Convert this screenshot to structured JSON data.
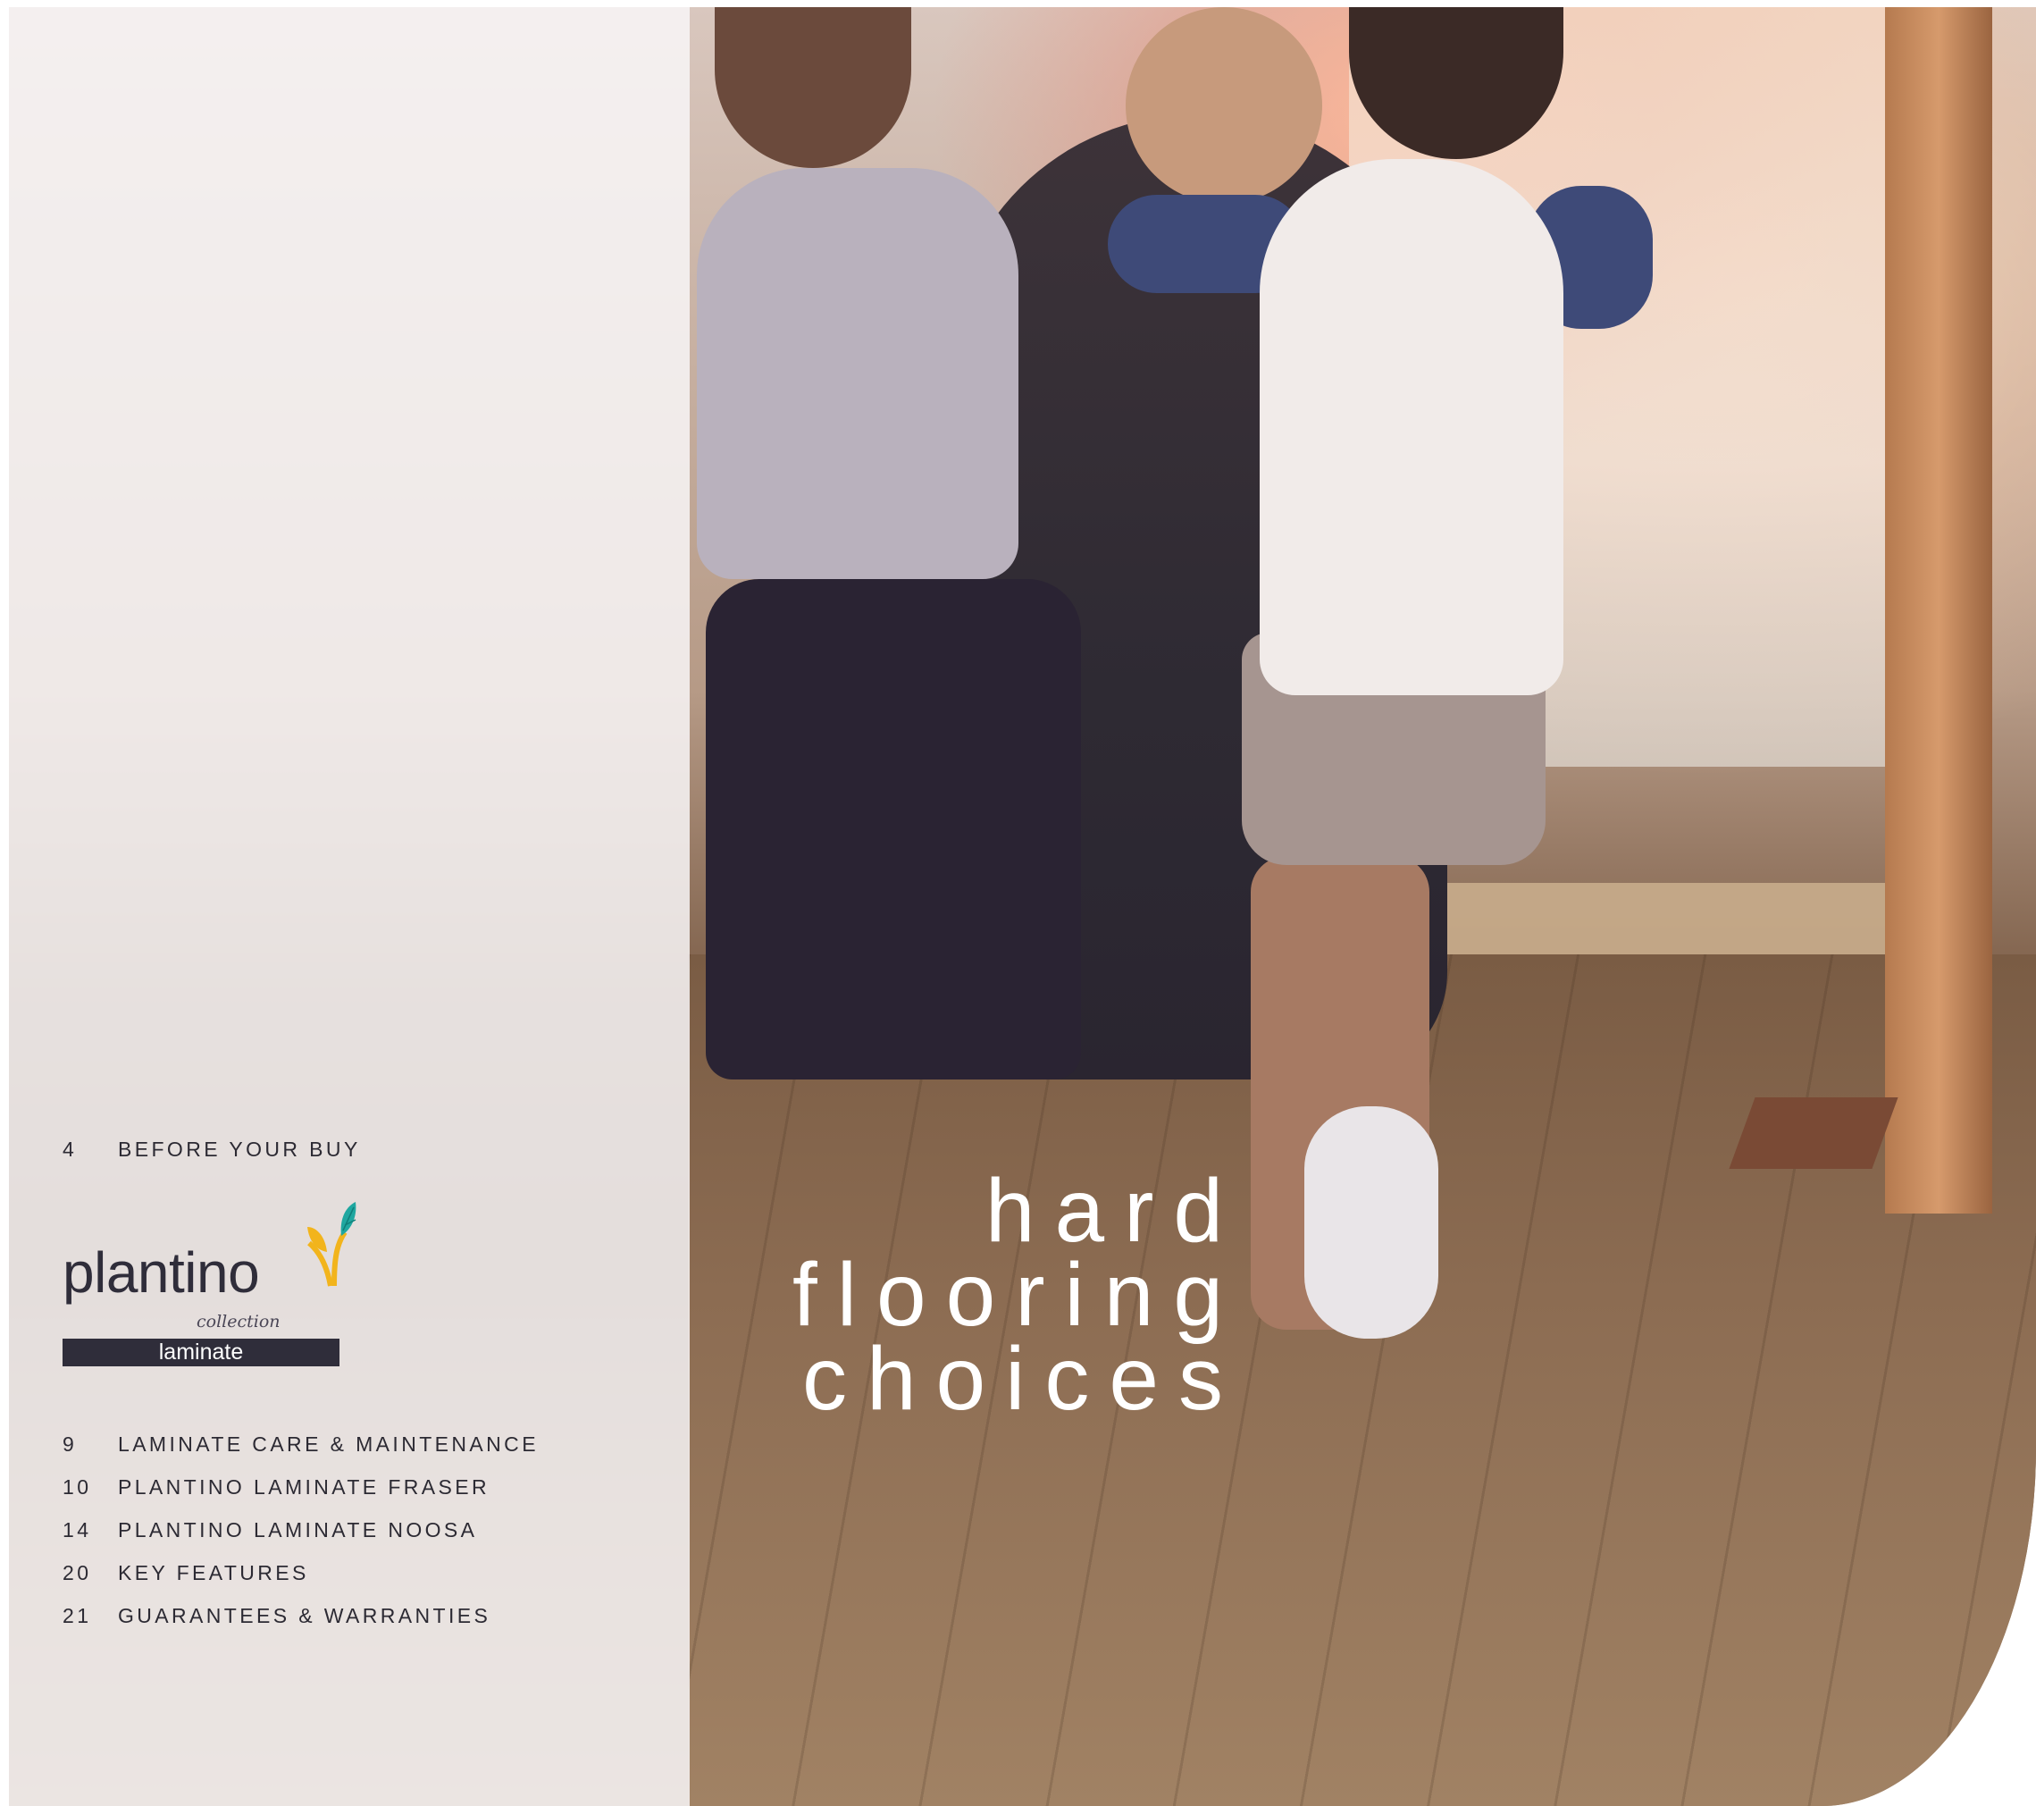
{
  "toc_top": [
    {
      "num": "4",
      "label": "BEFORE YOUR BUY"
    }
  ],
  "logo": {
    "brand": "plantino",
    "collection": "collection",
    "product": "laminate",
    "colors": {
      "teal": "#1fa7a0",
      "yellow": "#f2b41c",
      "navy": "#2f2d3a"
    }
  },
  "toc_bottom": [
    {
      "num": "9",
      "label": "LAMINATE CARE & MAINTENANCE"
    },
    {
      "num": "10",
      "label": "PLANTINO LAMINATE FRASER"
    },
    {
      "num": "14",
      "label": "PLANTINO LAMINATE NOOSA"
    },
    {
      "num": "20",
      "label": "KEY FEATURES"
    },
    {
      "num": "21",
      "label": "GUARANTEES & WARRANTIES"
    }
  ],
  "headline": {
    "line1": "hard",
    "line2": "flooring",
    "line3": "choices"
  }
}
